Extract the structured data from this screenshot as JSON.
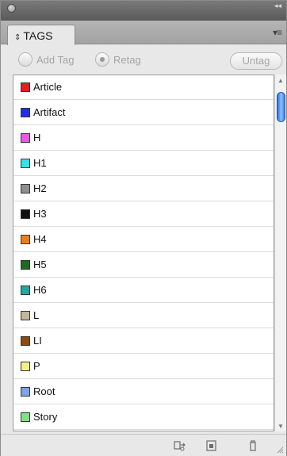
{
  "panel": {
    "tab_label": "TAGS",
    "tab_arrows": "⇕"
  },
  "toolbar": {
    "add_tag_label": "Add Tag",
    "retag_label": "Retag",
    "untag_label": "Untag",
    "selected_mode": "Retag"
  },
  "tags": [
    {
      "name": "Article",
      "color": "#e41f1f"
    },
    {
      "name": "Artifact",
      "color": "#1f2ee8"
    },
    {
      "name": "H",
      "color": "#e55be6"
    },
    {
      "name": "H1",
      "color": "#35e2e8"
    },
    {
      "name": "H2",
      "color": "#8f8f8f"
    },
    {
      "name": "H3",
      "color": "#111111"
    },
    {
      "name": "H4",
      "color": "#ef7d1a"
    },
    {
      "name": "H5",
      "color": "#1d6a22"
    },
    {
      "name": "H6",
      "color": "#24a6a0"
    },
    {
      "name": "L",
      "color": "#c7b59a"
    },
    {
      "name": "LI",
      "color": "#8c4a12"
    },
    {
      "name": "P",
      "color": "#f4f08a"
    },
    {
      "name": "Root",
      "color": "#7ea3e6"
    },
    {
      "name": "Story",
      "color": "#86e08a"
    }
  ],
  "icons": {
    "panel_menu": "panel-menu-icon",
    "map_styles": "map-styles-to-tags-icon",
    "new_tag": "new-tag-icon",
    "delete_tag": "delete-tag-icon"
  }
}
